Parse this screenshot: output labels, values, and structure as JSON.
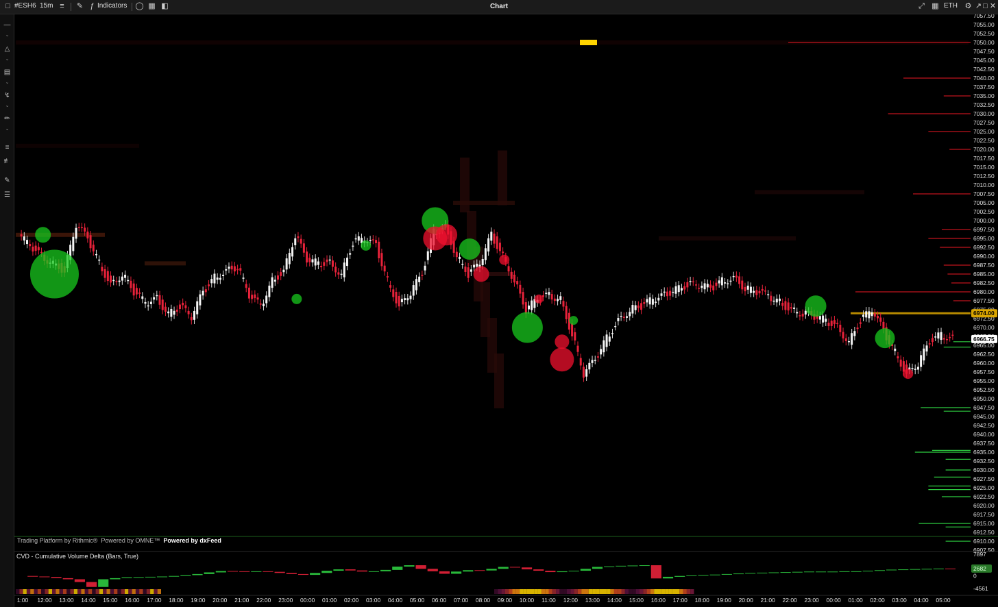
{
  "toolbar": {
    "symbol": "#ESH6",
    "interval": "15m",
    "indicators_label": "Indicators",
    "title": "Chart",
    "session": "ETH"
  },
  "icons": {
    "left_tools": [
      "minus-icon",
      "shape-icon",
      "bars-icon",
      "curve-icon",
      "ruler-icon",
      "fib-icon",
      "fib-ext-icon",
      "paint-icon",
      "list-icon"
    ],
    "top_right": [
      "expand-icon",
      "calendar-icon",
      "settings-icon",
      "share-icon",
      "maximize-icon",
      "close-icon"
    ]
  },
  "credits": {
    "rithmic": "Trading Platform by Rithmic®",
    "omne": "Powered by OMNE™",
    "dxfeed": "Powered by dxFeed"
  },
  "colors": {
    "background": "#000000",
    "up": "#2ecc40",
    "down": "#e8223a",
    "current_price_label": "#ffffff",
    "highlight_line": "#d9a400"
  },
  "chart_data": [
    {
      "type": "candlestick",
      "instrument": "#ESH6",
      "interval": "15m",
      "x_tick_labels": [
        "1:00",
        "12:00",
        "13:00",
        "14:00",
        "15:00",
        "16:00",
        "17:00",
        "18:00",
        "19:00",
        "20:00",
        "21:00",
        "22:00",
        "23:00",
        "00:00",
        "01:00",
        "02:00",
        "03:00",
        "04:00",
        "05:00",
        "06:00",
        "07:00",
        "08:00",
        "09:00",
        "10:00",
        "11:00",
        "12:00",
        "13:00",
        "14:00",
        "15:00",
        "16:00",
        "17:00",
        "18:00",
        "19:00",
        "20:00",
        "21:00",
        "22:00",
        "23:00",
        "00:00",
        "01:00",
        "02:00",
        "03:00",
        "04:00",
        "05:00"
      ],
      "y_tick_labels": [
        "7057.50",
        "7055.00",
        "7052.50",
        "7050.00",
        "7047.50",
        "7045.00",
        "7042.50",
        "7040.00",
        "7037.50",
        "7035.00",
        "7032.50",
        "7030.00",
        "7027.50",
        "7025.00",
        "7022.50",
        "7020.00",
        "7017.50",
        "7015.00",
        "7012.50",
        "7010.00",
        "7007.50",
        "7005.00",
        "7002.50",
        "7000.00",
        "6997.50",
        "6995.00",
        "6992.50",
        "6990.00",
        "6987.50",
        "6985.00",
        "6982.50",
        "6980.00",
        "6977.50",
        "6975.00",
        "6972.50",
        "6970.00",
        "6967.50",
        "6965.00",
        "6962.50",
        "6960.00",
        "6957.50",
        "6955.00",
        "6952.50",
        "6950.00",
        "6947.50",
        "6945.00",
        "6942.50",
        "6940.00",
        "6937.50",
        "6935.00",
        "6932.50",
        "6930.00",
        "6927.50",
        "6925.00",
        "6922.50",
        "6920.00",
        "6917.50",
        "6915.00",
        "6912.50",
        "6910.00",
        "6907.50"
      ],
      "ylim": [
        6907.5,
        7057.5
      ],
      "price_markers": [
        {
          "label": "6974.00",
          "value": 6974.0
        },
        {
          "label": "6966.75",
          "value": 6966.75
        }
      ],
      "price_path": [
        [
          0,
          6996
        ],
        [
          1,
          6993
        ],
        [
          2,
          6990
        ],
        [
          3,
          6988
        ],
        [
          4,
          6986
        ],
        [
          5,
          6999
        ],
        [
          6,
          6995
        ],
        [
          7,
          6988
        ],
        [
          8,
          6982
        ],
        [
          9,
          6985
        ],
        [
          10,
          6980
        ],
        [
          11,
          6977
        ],
        [
          12,
          6978
        ],
        [
          13,
          6974
        ],
        [
          14,
          6976
        ],
        [
          15,
          6973
        ],
        [
          16,
          6980
        ],
        [
          17,
          6984
        ],
        [
          18,
          6986
        ],
        [
          19,
          6987
        ],
        [
          20,
          6979
        ],
        [
          21,
          6976
        ],
        [
          22,
          6983
        ],
        [
          23,
          6986
        ],
        [
          24,
          6996
        ],
        [
          25,
          6989
        ],
        [
          26,
          6988
        ],
        [
          27,
          6988
        ],
        [
          28,
          6985
        ],
        [
          29,
          6994
        ],
        [
          30,
          6995
        ],
        [
          31,
          6993
        ],
        [
          32,
          6983
        ],
        [
          33,
          6976
        ],
        [
          34,
          6980
        ],
        [
          35,
          6985
        ],
        [
          36,
          6997
        ],
        [
          37,
          6998
        ],
        [
          38,
          6990
        ],
        [
          39,
          6985
        ],
        [
          40,
          6988
        ],
        [
          41,
          6996
        ],
        [
          42,
          6990
        ],
        [
          43,
          6983
        ],
        [
          44,
          6975
        ],
        [
          45,
          6978
        ],
        [
          46,
          6979
        ],
        [
          47,
          6978
        ],
        [
          48,
          6968
        ],
        [
          49,
          6957
        ],
        [
          50,
          6961
        ],
        [
          51,
          6967
        ],
        [
          52,
          6972
        ],
        [
          53,
          6975
        ],
        [
          54,
          6976
        ],
        [
          55,
          6978
        ],
        [
          56,
          6979
        ],
        [
          57,
          6981
        ],
        [
          58,
          6982
        ],
        [
          59,
          6982
        ],
        [
          60,
          6981
        ],
        [
          61,
          6983
        ],
        [
          62,
          6984
        ],
        [
          63,
          6981
        ],
        [
          64,
          6980
        ],
        [
          65,
          6979
        ],
        [
          66,
          6977
        ],
        [
          67,
          6975
        ],
        [
          68,
          6974
        ],
        [
          69,
          6973
        ],
        [
          70,
          6972
        ],
        [
          71,
          6970
        ],
        [
          72,
          6966
        ],
        [
          73,
          6972
        ],
        [
          74,
          6975
        ],
        [
          75,
          6969
        ],
        [
          76,
          6963
        ],
        [
          77,
          6957
        ],
        [
          78,
          6960
        ],
        [
          79,
          6966
        ],
        [
          80,
          6968
        ],
        [
          81,
          6966.75
        ]
      ],
      "bubbles": [
        {
          "i": 3,
          "price": 6985,
          "size": 70,
          "side": "buy"
        },
        {
          "i": 2,
          "price": 6996,
          "size": 22,
          "side": "buy"
        },
        {
          "i": 36,
          "price": 7000,
          "size": 38,
          "side": "buy"
        },
        {
          "i": 36,
          "price": 6995,
          "size": 34,
          "side": "sell"
        },
        {
          "i": 37,
          "price": 6996,
          "size": 30,
          "side": "sell"
        },
        {
          "i": 39,
          "price": 6992,
          "size": 30,
          "side": "buy"
        },
        {
          "i": 40,
          "price": 6985,
          "size": 22,
          "side": "sell"
        },
        {
          "i": 30,
          "price": 6993,
          "size": 14,
          "side": "buy"
        },
        {
          "i": 24,
          "price": 6978,
          "size": 14,
          "side": "buy"
        },
        {
          "i": 44,
          "price": 6970,
          "size": 44,
          "side": "buy"
        },
        {
          "i": 47,
          "price": 6961,
          "size": 34,
          "side": "sell"
        },
        {
          "i": 47,
          "price": 6966,
          "size": 20,
          "side": "sell"
        },
        {
          "i": 42,
          "price": 6989,
          "size": 14,
          "side": "sell"
        },
        {
          "i": 69,
          "price": 6976,
          "size": 30,
          "side": "buy"
        },
        {
          "i": 75,
          "price": 6967,
          "size": 28,
          "side": "buy"
        },
        {
          "i": 77,
          "price": 6957,
          "size": 14,
          "side": "sell"
        },
        {
          "i": 48,
          "price": 6972,
          "size": 12,
          "side": "buy"
        },
        {
          "i": 45,
          "price": 6978,
          "size": 12,
          "side": "sell"
        }
      ],
      "depth_levels": [
        {
          "price": 7050.0,
          "side": "ask",
          "size": 0.95
        },
        {
          "price": 7040.0,
          "side": "ask",
          "size": 0.35
        },
        {
          "price": 7035.0,
          "side": "ask",
          "size": 0.14
        },
        {
          "price": 7030.0,
          "side": "ask",
          "size": 0.43
        },
        {
          "price": 7025.0,
          "side": "ask",
          "size": 0.22
        },
        {
          "price": 7020.0,
          "side": "ask",
          "size": 0.11
        },
        {
          "price": 7007.5,
          "side": "ask",
          "size": 0.3
        },
        {
          "price": 6997.5,
          "side": "ask",
          "size": 0.15
        },
        {
          "price": 6995.0,
          "side": "ask",
          "size": 0.22
        },
        {
          "price": 6992.5,
          "side": "ask",
          "size": 0.16
        },
        {
          "price": 6987.5,
          "side": "ask",
          "size": 0.14
        },
        {
          "price": 6985.0,
          "side": "ask",
          "size": 0.12
        },
        {
          "price": 6982.5,
          "side": "ask",
          "size": 0.1
        },
        {
          "price": 6980.0,
          "side": "ask",
          "size": 0.6
        },
        {
          "price": 6977.5,
          "side": "ask",
          "size": 0.09
        },
        {
          "price": 6966.0,
          "side": "bid",
          "size": 0.09
        },
        {
          "price": 6964.5,
          "side": "bid",
          "size": 0.14
        },
        {
          "price": 6947.5,
          "side": "bid",
          "size": 0.26
        },
        {
          "price": 6946.5,
          "side": "bid",
          "size": 0.14
        },
        {
          "price": 6935.5,
          "side": "bid",
          "size": 0.2
        },
        {
          "price": 6935.0,
          "side": "bid",
          "size": 0.29
        },
        {
          "price": 6933.0,
          "side": "bid",
          "size": 0.13
        },
        {
          "price": 6930.0,
          "side": "bid",
          "size": 0.13
        },
        {
          "price": 6928.0,
          "side": "bid",
          "size": 0.19
        },
        {
          "price": 6925.5,
          "side": "bid",
          "size": 0.22
        },
        {
          "price": 6924.5,
          "side": "bid",
          "size": 0.22
        },
        {
          "price": 6922.5,
          "side": "bid",
          "size": 0.15
        },
        {
          "price": 6915.0,
          "side": "bid",
          "size": 0.27
        },
        {
          "price": 6914.0,
          "side": "bid",
          "size": 0.13
        },
        {
          "price": 6910.0,
          "side": "bid",
          "size": 0.13
        }
      ]
    },
    {
      "type": "bar",
      "title": "CVD - Cumulative Volume Delta (Bars, True)",
      "y_tick_labels": [
        "7897",
        "0",
        "-4561"
      ],
      "last_value_label": "2682",
      "ylim": [
        -4561,
        7897
      ],
      "values": [
        0,
        -200,
        -400,
        -800,
        -1200,
        -2200,
        -4000,
        -1200,
        -800,
        -500,
        -400,
        -300,
        -200,
        0,
        300,
        700,
        1300,
        1800,
        1700,
        1500,
        1700,
        1500,
        1100,
        700,
        400,
        1100,
        1900,
        2400,
        2000,
        1600,
        1700,
        2200,
        3400,
        3900,
        2600,
        1700,
        800,
        1600,
        2100,
        2000,
        2600,
        3300,
        3100,
        2400,
        1900,
        1400,
        1700,
        1900,
        2600,
        3300,
        3500,
        3700,
        3800,
        3900,
        -900,
        -300,
        0,
        200,
        400,
        500,
        700,
        900,
        1100,
        1200,
        1300,
        1400,
        1500,
        1600,
        1600,
        1600,
        1700,
        1700,
        1900,
        2100,
        2300,
        2400,
        2500,
        2600,
        2700,
        2682
      ]
    }
  ]
}
